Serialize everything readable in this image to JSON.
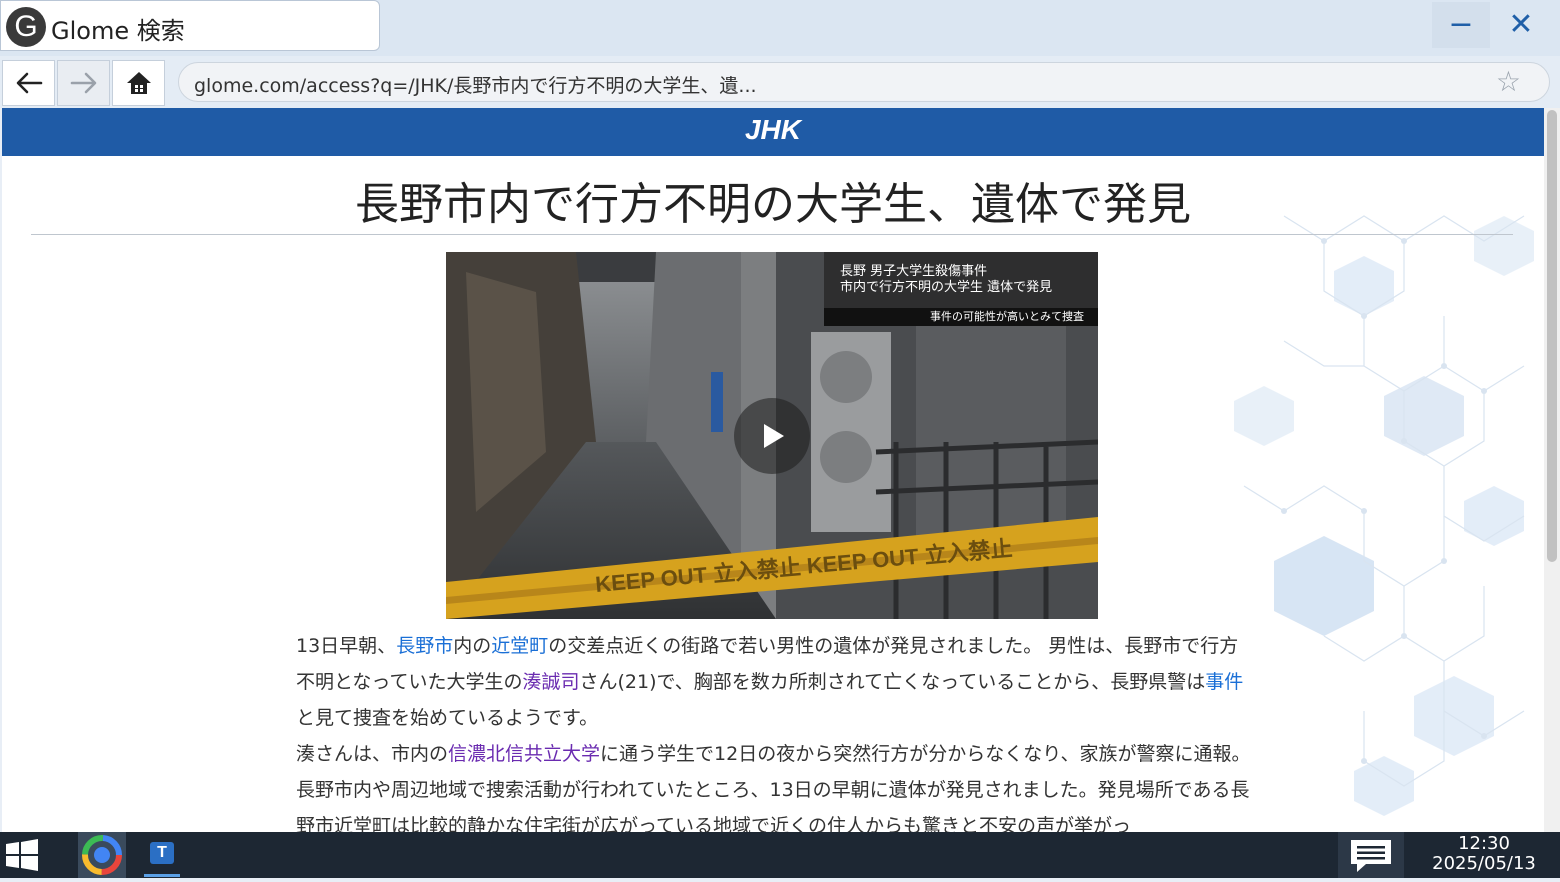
{
  "browser": {
    "tab_logo": "G",
    "tab_title": "Glome 検索",
    "minimize_symbol": "−",
    "close_symbol": "✕",
    "url": "glome.com/access?q=/JHK/長野市内で行方不明の大学生、遺...",
    "bookmark_symbol": "☆"
  },
  "site": {
    "brand": "JHK",
    "brand_color": "#1f5ba6",
    "headline": "長野市内で行方不明の大学生、遺体で発見"
  },
  "video": {
    "caption_line1": "長野 男子大学生殺傷事件",
    "caption_line2": "市内で行方不明の大学生 遺体で発見",
    "caption_sub": "事件の可能性が高いとみて捜査",
    "tape_text": "KEEP OUT 立入禁止 KEEP OUT 立入禁止"
  },
  "article": {
    "p1": {
      "t1": "13日早朝、",
      "l1": "長野市",
      "t2": "内の",
      "l2": "近堂町",
      "t3": "の交差点近くの街路で若い男性の遺体が発見されました。 男性は、長野市で行方不明となっていた大学生の",
      "l3": "湊誠司",
      "t4": "さん(21)で、胸部を数カ所刺されて亡くなっていることから、長野県警は",
      "l4": "事件",
      "t5": "と見て捜査を始めているようです。"
    },
    "p2": {
      "t1": "湊さんは、市内の",
      "l1": "信濃北信共立大学",
      "t2": "に通う学生で12日の夜から突然行方が分からなくなり、家族が警察に通報。長野市内や周辺地域で捜索活動が行われていたところ、13日の早朝に遺体が発見されました。発見場所である長野市近堂町は比較的静かな住宅街が広がっている地域で近くの住人からも驚きと不安の声が挙がっ"
    }
  },
  "taskbar": {
    "time": "12:30",
    "date": "2025/05/13",
    "tutor_letter": "T"
  }
}
